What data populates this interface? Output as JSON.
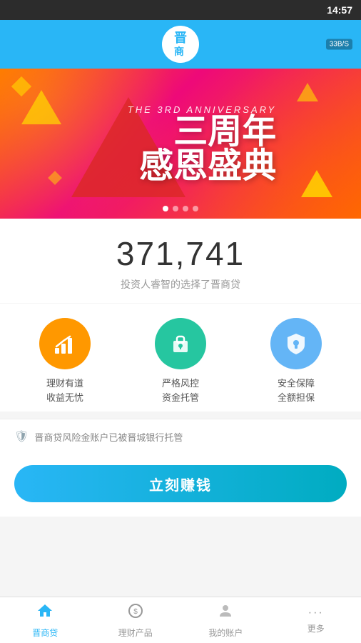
{
  "statusBar": {
    "time": "14:57",
    "wifi": "33B/S"
  },
  "header": {
    "logoText": "晋",
    "logoSubText": "商"
  },
  "banner": {
    "subtitle": "THE 3RD ANNIVERSARY",
    "line1": "三周年",
    "line2": "感恩盛典",
    "dots": [
      true,
      false,
      false,
      false
    ]
  },
  "stats": {
    "number": "371,741",
    "subtitle": "投资人睿智的选择了晋商贷"
  },
  "features": [
    {
      "iconType": "orange",
      "iconChar": "📈",
      "line1": "理财有道",
      "line2": "收益无忧"
    },
    {
      "iconType": "teal",
      "iconChar": "🔒",
      "line1": "严格风控",
      "line2": "资金托管"
    },
    {
      "iconType": "blue",
      "iconChar": "🛡",
      "line1": "安全保障",
      "line2": "全额担保"
    }
  ],
  "notice": {
    "iconChar": "🛡",
    "text": "晋商贷风险金账户已被晋城银行托管"
  },
  "cta": {
    "label": "立刻赚钱"
  },
  "nav": [
    {
      "label": "晋商贷",
      "icon": "🏠",
      "active": true
    },
    {
      "label": "理财产品",
      "icon": "💰",
      "active": false
    },
    {
      "label": "我的账户",
      "icon": "👤",
      "active": false
    },
    {
      "label": "更多",
      "icon": "···",
      "active": false
    }
  ]
}
